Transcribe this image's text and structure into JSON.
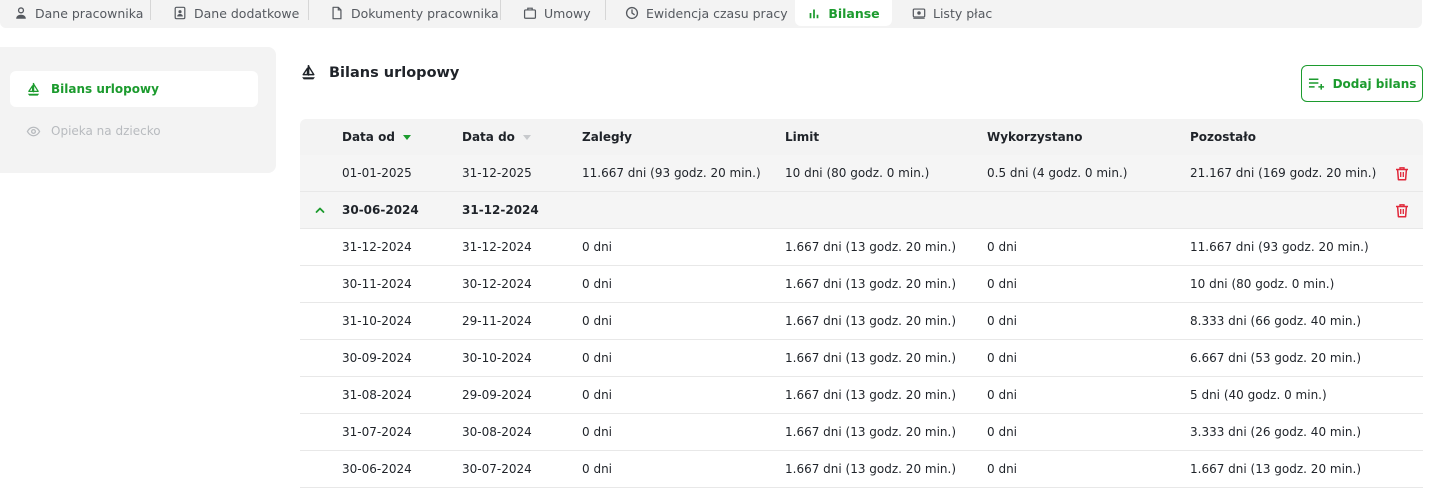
{
  "tabs": [
    {
      "label": "Dane pracownika",
      "icon": "person-icon",
      "active": false
    },
    {
      "label": "Dane dodatkowe",
      "icon": "id-badge-icon",
      "active": false
    },
    {
      "label": "Dokumenty pracownika",
      "icon": "document-icon",
      "active": false
    },
    {
      "label": "Umowy",
      "icon": "briefcase-icon",
      "active": false
    },
    {
      "label": "Ewidencja czasu pracy",
      "icon": "clock-icon",
      "active": false
    },
    {
      "label": "Bilanse",
      "icon": "bar-chart-icon",
      "active": true
    },
    {
      "label": "Listy płac",
      "icon": "money-icon",
      "active": false
    }
  ],
  "sidebar": {
    "items": [
      {
        "label": "Bilans urlopowy",
        "icon": "sailboat-icon",
        "state": "active"
      },
      {
        "label": "Opieka na dziecko",
        "icon": "eye-icon",
        "state": "disabled"
      }
    ]
  },
  "section": {
    "title": "Bilans urlopowy",
    "add_label": "Dodaj bilans"
  },
  "table": {
    "headers": [
      "Data od",
      "Data do",
      "Zaległy",
      "Limit",
      "Wykorzystano",
      "Pozostało"
    ],
    "sort_column": "Data od",
    "rows": [
      {
        "cells": [
          "01-01-2025",
          "31-12-2025",
          "11.667 dni (93 godz. 20 min.)",
          "10 dni (80 godz. 0 min.)",
          "0.5 dni (4 godz. 0 min.)",
          "21.167 dni (169 godz. 20 min.)"
        ]
      }
    ],
    "group": {
      "cells": [
        "30-06-2024",
        "31-12-2024"
      ],
      "expanded": true,
      "children": [
        {
          "cells": [
            "31-12-2024",
            "31-12-2024",
            "0 dni",
            "1.667 dni (13 godz. 20 min.)",
            "0 dni",
            "11.667 dni (93 godz. 20 min.)"
          ]
        },
        {
          "cells": [
            "30-11-2024",
            "30-12-2024",
            "0 dni",
            "1.667 dni (13 godz. 20 min.)",
            "0 dni",
            "10 dni (80 godz. 0 min.)"
          ]
        },
        {
          "cells": [
            "31-10-2024",
            "29-11-2024",
            "0 dni",
            "1.667 dni (13 godz. 20 min.)",
            "0 dni",
            "8.333 dni (66 godz. 40 min.)"
          ]
        },
        {
          "cells": [
            "30-09-2024",
            "30-10-2024",
            "0 dni",
            "1.667 dni (13 godz. 20 min.)",
            "0 dni",
            "6.667 dni (53 godz. 20 min.)"
          ]
        },
        {
          "cells": [
            "31-08-2024",
            "29-09-2024",
            "0 dni",
            "1.667 dni (13 godz. 20 min.)",
            "0 dni",
            "5 dni (40 godz. 0 min.)"
          ]
        },
        {
          "cells": [
            "31-07-2024",
            "30-08-2024",
            "0 dni",
            "1.667 dni (13 godz. 20 min.)",
            "0 dni",
            "3.333 dni (26 godz. 40 min.)"
          ]
        },
        {
          "cells": [
            "30-06-2024",
            "30-07-2024",
            "0 dni",
            "1.667 dni (13 godz. 20 min.)",
            "0 dni",
            "1.667 dni (13 godz. 20 min.)"
          ]
        }
      ]
    }
  },
  "colors": {
    "accent": "#1c9b2e",
    "delete": "#e0283a",
    "panel": "#f3f3f3"
  }
}
